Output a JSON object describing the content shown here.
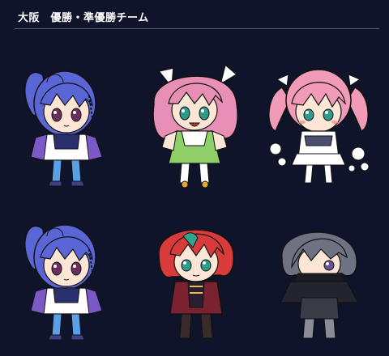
{
  "header": {
    "title": "大阪　優勝・準優勝チーム"
  },
  "characters": [
    {
      "row": 1,
      "col": 1,
      "hair": "blue-ponytail"
    },
    {
      "row": 1,
      "col": 2,
      "hair": "pink-wavy-ears"
    },
    {
      "row": 1,
      "col": 3,
      "hair": "pink-twintails"
    },
    {
      "row": 2,
      "col": 1,
      "hair": "blue-ponytail"
    },
    {
      "row": 2,
      "col": 2,
      "hair": "red-braid"
    },
    {
      "row": 2,
      "col": 3,
      "hair": "gray-masked"
    }
  ],
  "colors": {
    "background": "#10142a",
    "divider": "#5a6174",
    "title": "#ffffff"
  }
}
